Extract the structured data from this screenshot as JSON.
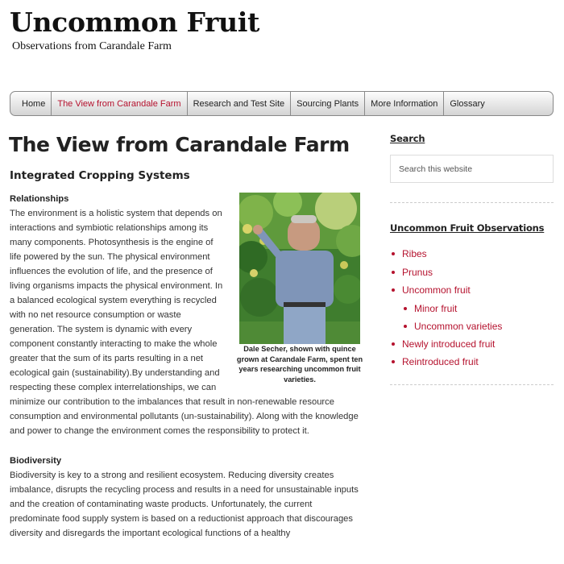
{
  "site": {
    "title": "Uncommon Fruit",
    "description": "Observations from Carandale Farm"
  },
  "nav": {
    "items": [
      {
        "label": "Home"
      },
      {
        "label": "The View from Carandale Farm",
        "current": true
      },
      {
        "label": "Research and Test Site"
      },
      {
        "label": "Sourcing Plants"
      },
      {
        "label": "More Information"
      },
      {
        "label": "Glossary"
      }
    ]
  },
  "main": {
    "title": "The View from Carandale Farm",
    "subtitle": "Integrated Cropping Systems",
    "sections": [
      {
        "heading": "Relationships",
        "text": "The environment is a holistic system that depends on interactions and symbiotic relationships among its many components. Photosynthesis is the engine of life powered by the sun. The physical environment influences the evolution of life, and the presence of living organisms impacts the physical environment. In a balanced ecological system everything is recycled with no net resource consumption or waste generation. The system is dynamic with every component constantly interacting to make the whole greater that the sum of its parts resulting in a net ecological gain (sustainability).By understanding and respecting these complex interrelationships, we can minimize our contribution to the imbalances that result in non-renewable resource consumption and environmental pollutants (un-sustainability). Along with the knowledge and power to change the environment comes the responsibility to protect it."
      },
      {
        "heading": "Biodiversity",
        "text": "Biodiversity is key to a strong and resilient ecosystem. Reducing diversity creates imbalance, disrupts the recycling process and results in a need for unsustainable inputs and the creation of contaminating waste products. Unfortunately, the current predominate food supply system is based on a reductionist approach that discourages diversity and disregards the important ecological functions of a healthy"
      }
    ],
    "figure": {
      "caption": "Dale Secher, shown with quince grown at Carandale Farm, spent ten years researching uncommon fruit varieties."
    }
  },
  "sidebar": {
    "search": {
      "title": "Search",
      "placeholder": "Search this website"
    },
    "observations": {
      "title": "Uncommon Fruit Observations",
      "items": [
        {
          "label": "Ribes",
          "level": 0
        },
        {
          "label": "Prunus",
          "level": 0
        },
        {
          "label": "Uncommon fruit",
          "level": 0
        },
        {
          "label": "Minor fruit",
          "level": 1
        },
        {
          "label": "Uncommon varieties",
          "level": 1
        },
        {
          "label": "Newly introduced fruit",
          "level": 0
        },
        {
          "label": "Reintroduced fruit",
          "level": 0
        }
      ]
    }
  },
  "colors": {
    "accent": "#b5122e",
    "text": "#222222"
  }
}
